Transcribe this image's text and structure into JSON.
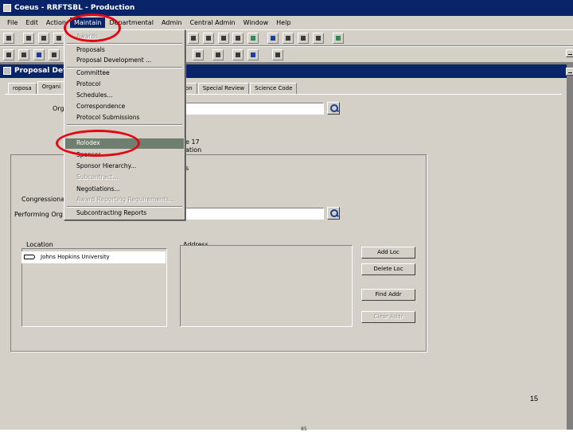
{
  "app": {
    "title": "Coeus - RRFTSBL - Production"
  },
  "menubar": {
    "items": [
      "File",
      "Edit",
      "Action",
      "Maintain",
      "Departmental",
      "Admin",
      "Central Admin",
      "Window",
      "Help"
    ]
  },
  "window": {
    "title": "Proposal Deta"
  },
  "tabs": [
    "roposa",
    "Organi",
    "ion",
    "Special Review",
    "Science Code"
  ],
  "form": {
    "org_label": "Org",
    "mid_text_1": "e 17",
    "mid_text_2": "ation",
    "mid_text_3": "s",
    "congressional_label": "Congressiona",
    "performing_org_label": "Performing Org"
  },
  "location_panel": {
    "location_header": "Location",
    "address_header": "Address",
    "rows": [
      "Johns Hopkins University"
    ]
  },
  "buttons": {
    "add_loc": "Add Loc",
    "delete_loc": "Delete Loc",
    "find_addr": "Find Addr",
    "clear_addr": "Clear Addr"
  },
  "dropdown": {
    "items": [
      "Awards",
      "Proposals",
      "Proposal Development ...",
      "Committee",
      "Protocol",
      "Schedules...",
      "Correspondence",
      "Protocol Submissions",
      "Rolodex",
      "Sponsor",
      "Sponsor Hierarchy...",
      "Subcontract...",
      "Negotiations...",
      "Award Reporting Requirements...",
      "Subcontracting Reports"
    ],
    "highlighted": "Rolodex"
  },
  "slide": {
    "page_number": "15",
    "bottom_text": "85"
  },
  "colors": {
    "title_bar": "#0a246a",
    "chrome": "#d4d0c8",
    "annotation": "#e30613",
    "highlight": "#6f7f6f"
  }
}
